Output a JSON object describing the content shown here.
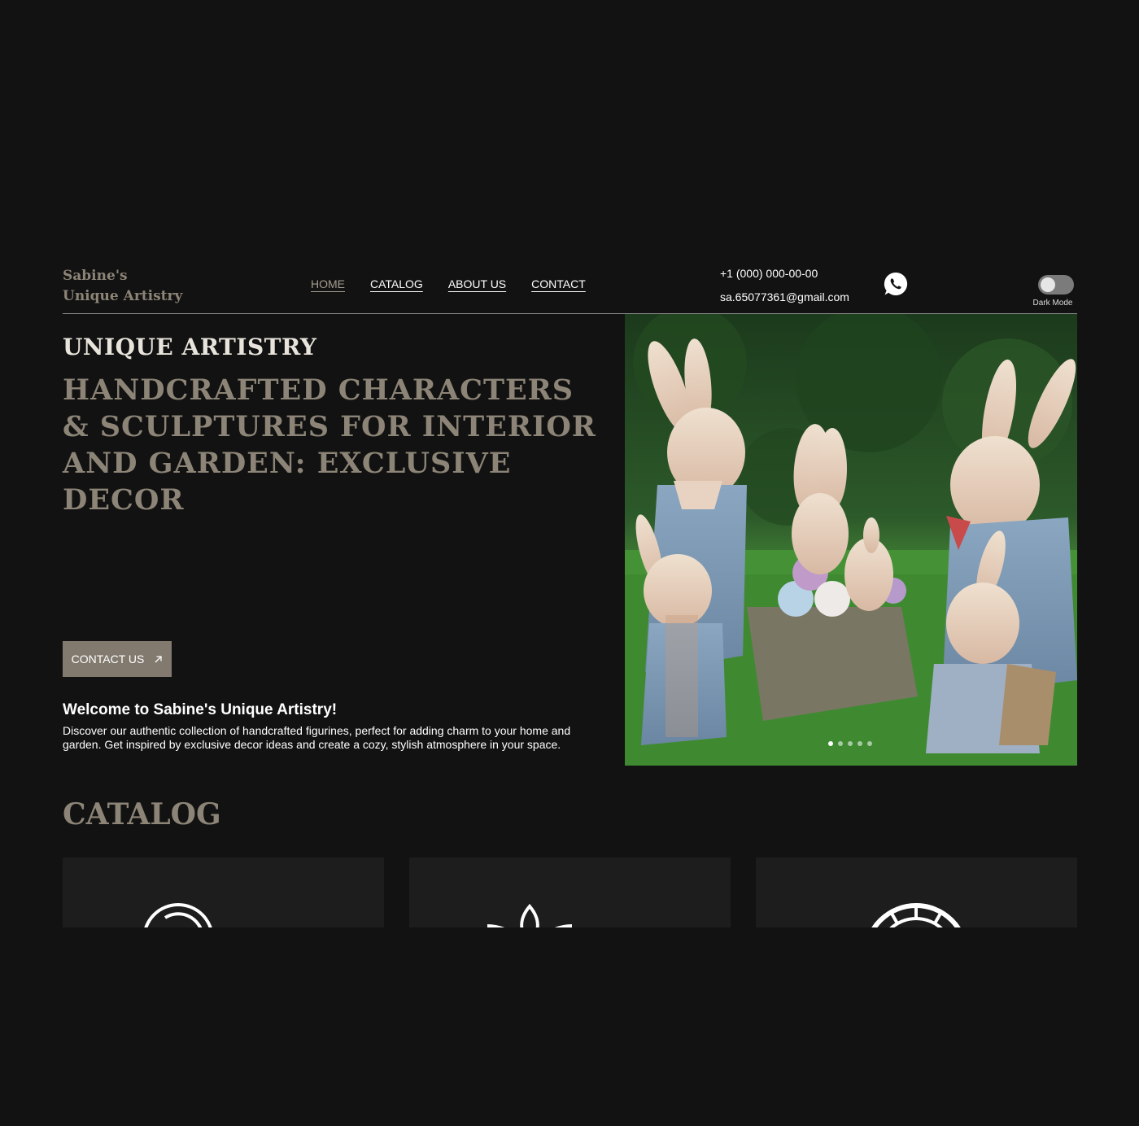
{
  "header": {
    "logo_line1": "Sabine's",
    "logo_line2": "Unique Artistry",
    "nav": [
      {
        "label": "HOME"
      },
      {
        "label": "CATALOG"
      },
      {
        "label": "ABOUT US"
      },
      {
        "label": "CONTACT"
      }
    ],
    "phone": "+1 (000) 000-00-00",
    "email": "sa.65077361@gmail.com",
    "whatsapp_icon": "whatsapp-icon",
    "dark_mode_label": "Dark Mode"
  },
  "hero": {
    "kicker": "UNIQUE ARTISTRY",
    "title": "HANDCRAFTED CHARACTERS & SCULPTURES FOR INTERIOR AND GARDEN: EXCLUSIVE DECOR",
    "cta_label": "CONTACT US",
    "cta_icon": "arrow-up-right-icon",
    "welcome_heading": "Welcome to Sabine's Unique Artistry!",
    "welcome_text": "Discover our authentic collection of handcrafted figurines, perfect for adding charm to your home and garden. Get inspired by exclusive decor ideas and create a cozy, stylish atmosphere in your space.",
    "slider_dots": 5,
    "active_slide": 1
  },
  "catalog": {
    "title": "CATALOG",
    "card_icons": [
      "wreath-icon",
      "lotus-icon",
      "sun-wheel-icon"
    ]
  },
  "colors": {
    "background": "#121212",
    "accent": "#8c8476",
    "button": "#827a6f",
    "card": "#1d1d1d"
  }
}
